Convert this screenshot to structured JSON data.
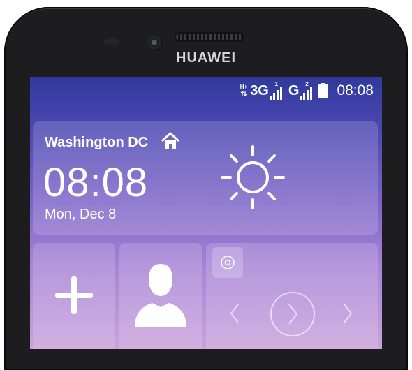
{
  "device": {
    "brand": "HUAWEI"
  },
  "status_bar": {
    "network1": "H+",
    "net1_type": "3G",
    "sim1_label": "1",
    "net2_type": "G",
    "sim2_label": "2",
    "time": "08:08"
  },
  "weather_widget": {
    "city": "Washington DC",
    "time": "08:08",
    "date": "Mon, Dec 8",
    "condition_icon": "sun-icon",
    "home_icon": "home-icon"
  },
  "tiles": {
    "add_icon": "plus-icon",
    "contacts_icon": "contact-icon",
    "music_icons": [
      "disc-icon",
      "prev-icon",
      "play-icon",
      "next-icon"
    ]
  },
  "colors": {
    "bezel": "#1d1d1f",
    "screen_top": "#2f3a9c",
    "screen_bottom": "#caa2dc",
    "text": "#ffffff"
  }
}
